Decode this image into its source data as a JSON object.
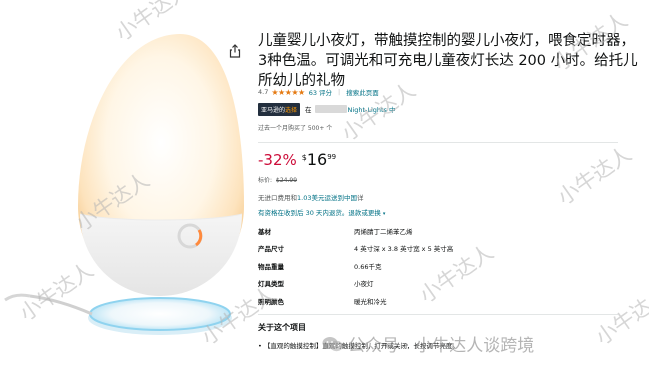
{
  "product": {
    "title": "儿童婴儿小夜灯，带触摸控制的婴儿小夜灯，喂食定时器，3种色温。可调光和可充电儿童夜灯长达 200 小时。给托儿所幼儿的礼物",
    "rating": "4.7",
    "stars": "★★★★★",
    "star_count": 4.7,
    "review_count": "63 评分",
    "search_link": "搜索此页面",
    "badge_prefix": "亚马逊的",
    "badge_accent": "选择",
    "badge_in": "在",
    "category": "Night-Lights 中",
    "bought": "过去一个月购买了 500+ 个",
    "discount": "-32%",
    "currency": "$",
    "price_whole": "16",
    "price_fraction": "99",
    "list_price_label": "标价:",
    "list_price": "$24.99",
    "import_prefix": "无进口费用和",
    "import_link": "1.03美元运送到中国",
    "import_suffix": "详",
    "return_text": "有资格在收到后 30 天内退货。退款或更换",
    "specs": [
      {
        "key": "基材",
        "value": "丙烯腈丁二烯苯乙烯"
      },
      {
        "key": "产品尺寸",
        "value": "4 英寸深 x 3.8 英寸宽 x 5 英寸高"
      },
      {
        "key": "物品重量",
        "value": "0.66千克"
      },
      {
        "key": "灯具类型",
        "value": "小夜灯"
      },
      {
        "key": "照明颜色",
        "value": "暖光和冷光"
      }
    ],
    "about_title": "关于这个项目",
    "about_bullet": "• 【直观的触摸控制】直观的触摸控制，打开或关闭，长按调节亮度。"
  },
  "watermark": {
    "text": "小牛达人",
    "wechat_text": "公众号 · 小牛达人谈跨境"
  },
  "colors": {
    "discount": "#cc0c39",
    "link": "#007185",
    "star": "#e47911",
    "badge_bg": "#232f3e",
    "badge_accent": "#ff9900",
    "ring_light": "#ff8a3d"
  },
  "icons": {
    "share": "share-icon",
    "wechat": "wechat-icon"
  }
}
